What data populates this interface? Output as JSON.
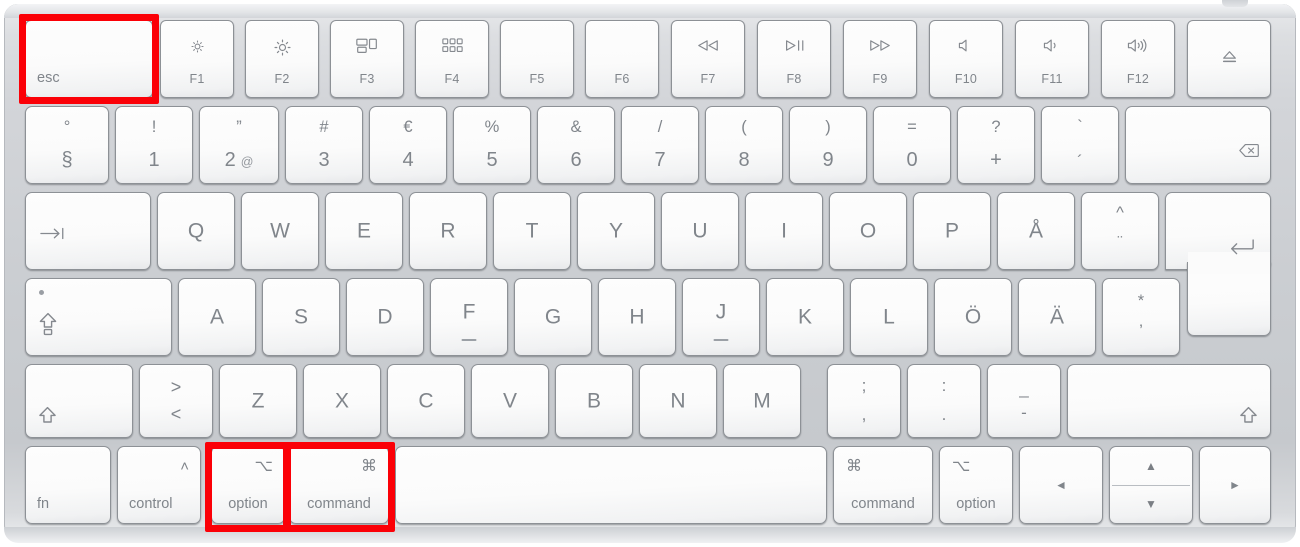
{
  "meta": {
    "device": "Apple Magic Keyboard",
    "layout": "Swedish (Nordic) ISO",
    "highlight_color": "#fb0007",
    "body_color": "#cbced2",
    "key_color": "#fbfbfb",
    "legend_color": "#80858b"
  },
  "highlights": [
    {
      "name": "esc",
      "label": "esc"
    },
    {
      "name": "option",
      "label": "option"
    },
    {
      "name": "command",
      "label": "command"
    }
  ],
  "rows": {
    "function_row": [
      {
        "name": "esc",
        "label": "esc",
        "glyph": "",
        "fn": ""
      },
      {
        "name": "f1",
        "label": "",
        "glyph": "brightness-down-icon",
        "fn": "F1"
      },
      {
        "name": "f2",
        "label": "",
        "glyph": "brightness-up-icon",
        "fn": "F2"
      },
      {
        "name": "f3",
        "label": "",
        "glyph": "mission-control-icon",
        "fn": "F3"
      },
      {
        "name": "f4",
        "label": "",
        "glyph": "launchpad-icon",
        "fn": "F4"
      },
      {
        "name": "f5",
        "label": "",
        "glyph": "",
        "fn": "F5"
      },
      {
        "name": "f6",
        "label": "",
        "glyph": "",
        "fn": "F6"
      },
      {
        "name": "f7",
        "label": "",
        "glyph": "◁◁",
        "fn": "F7"
      },
      {
        "name": "f8",
        "label": "",
        "glyph": "▷‖",
        "fn": "F8"
      },
      {
        "name": "f9",
        "label": "",
        "glyph": "▷▷",
        "fn": "F9"
      },
      {
        "name": "f10",
        "label": "",
        "glyph": "mute-icon",
        "fn": "F10"
      },
      {
        "name": "f11",
        "label": "",
        "glyph": "volume-down-icon",
        "fn": "F11"
      },
      {
        "name": "f12",
        "label": "",
        "glyph": "volume-up-icon",
        "fn": "F12"
      },
      {
        "name": "eject",
        "label": "",
        "glyph": "eject-icon",
        "fn": ""
      }
    ],
    "number_row": [
      {
        "name": "section",
        "upper": "°",
        "lower": "§"
      },
      {
        "name": "1",
        "upper": "!",
        "lower": "1"
      },
      {
        "name": "2",
        "upper": "”",
        "lower": "2",
        "extra": "@"
      },
      {
        "name": "3",
        "upper": "#",
        "lower": "3"
      },
      {
        "name": "4",
        "upper": "€",
        "lower": "4"
      },
      {
        "name": "5",
        "upper": "%",
        "lower": "5"
      },
      {
        "name": "6",
        "upper": "&",
        "lower": "6"
      },
      {
        "name": "7",
        "upper": "/",
        "lower": "7"
      },
      {
        "name": "8",
        "upper": "(",
        "lower": "8"
      },
      {
        "name": "9",
        "upper": ")",
        "lower": "9"
      },
      {
        "name": "0",
        "upper": "=",
        "lower": "0"
      },
      {
        "name": "plus",
        "upper": "?",
        "lower": "+"
      },
      {
        "name": "acute",
        "upper": "`",
        "lower": "´"
      },
      {
        "name": "delete",
        "glyph": "delete-icon"
      }
    ],
    "top_row": [
      {
        "name": "tab",
        "glyph": "tab-icon"
      },
      {
        "name": "q",
        "label": "Q"
      },
      {
        "name": "w",
        "label": "W"
      },
      {
        "name": "e",
        "label": "E"
      },
      {
        "name": "r",
        "label": "R"
      },
      {
        "name": "t",
        "label": "T"
      },
      {
        "name": "y",
        "label": "Y"
      },
      {
        "name": "u",
        "label": "U"
      },
      {
        "name": "i",
        "label": "I"
      },
      {
        "name": "o",
        "label": "O"
      },
      {
        "name": "p",
        "label": "P"
      },
      {
        "name": "aring",
        "label": "Å"
      },
      {
        "name": "diaeresis",
        "upper": "^",
        "lower": "¨"
      },
      {
        "name": "enter",
        "glyph": "return-icon"
      }
    ],
    "home_row": [
      {
        "name": "capslock",
        "glyph": "caps-lock-icon"
      },
      {
        "name": "a",
        "label": "A"
      },
      {
        "name": "s",
        "label": "S"
      },
      {
        "name": "d",
        "label": "D"
      },
      {
        "name": "f",
        "label": "F",
        "homing": true
      },
      {
        "name": "g",
        "label": "G"
      },
      {
        "name": "h",
        "label": "H"
      },
      {
        "name": "j",
        "label": "J",
        "homing": true
      },
      {
        "name": "k",
        "label": "K"
      },
      {
        "name": "l",
        "label": "L"
      },
      {
        "name": "odiaeresis",
        "label": "Ö"
      },
      {
        "name": "adiaeresis",
        "label": "Ä"
      },
      {
        "name": "apostrophe",
        "upper": "*",
        "lower": "’"
      }
    ],
    "bottom_letter_row": [
      {
        "name": "shift-left",
        "glyph": "shift-icon"
      },
      {
        "name": "less-greater",
        "upper": ">",
        "lower": "<"
      },
      {
        "name": "z",
        "label": "Z"
      },
      {
        "name": "x",
        "label": "X"
      },
      {
        "name": "c",
        "label": "C"
      },
      {
        "name": "v",
        "label": "V"
      },
      {
        "name": "b",
        "label": "B"
      },
      {
        "name": "n",
        "label": "N"
      },
      {
        "name": "m",
        "label": "M"
      },
      {
        "name": "semicolon",
        "upper": ";",
        "lower": ","
      },
      {
        "name": "colon",
        "upper": ":",
        "lower": "."
      },
      {
        "name": "hyphen",
        "upper": "_",
        "lower": "-"
      },
      {
        "name": "shift-right",
        "glyph": "shift-icon"
      }
    ],
    "modifier_row": [
      {
        "name": "fn",
        "label": "fn"
      },
      {
        "name": "control",
        "label": "control",
        "glyph": "˄"
      },
      {
        "name": "option-left",
        "label": "option",
        "glyph": "⌥"
      },
      {
        "name": "command-left",
        "label": "command",
        "glyph": "⌘"
      },
      {
        "name": "space",
        "label": ""
      },
      {
        "name": "command-right",
        "label": "command",
        "glyph": "⌘"
      },
      {
        "name": "option-right",
        "label": "option",
        "glyph": "⌥"
      },
      {
        "name": "arrow-left",
        "glyph": "◄"
      },
      {
        "name": "arrow-up",
        "glyph": "▲"
      },
      {
        "name": "arrow-down",
        "glyph": "▼"
      },
      {
        "name": "arrow-right",
        "glyph": "►"
      }
    ]
  }
}
